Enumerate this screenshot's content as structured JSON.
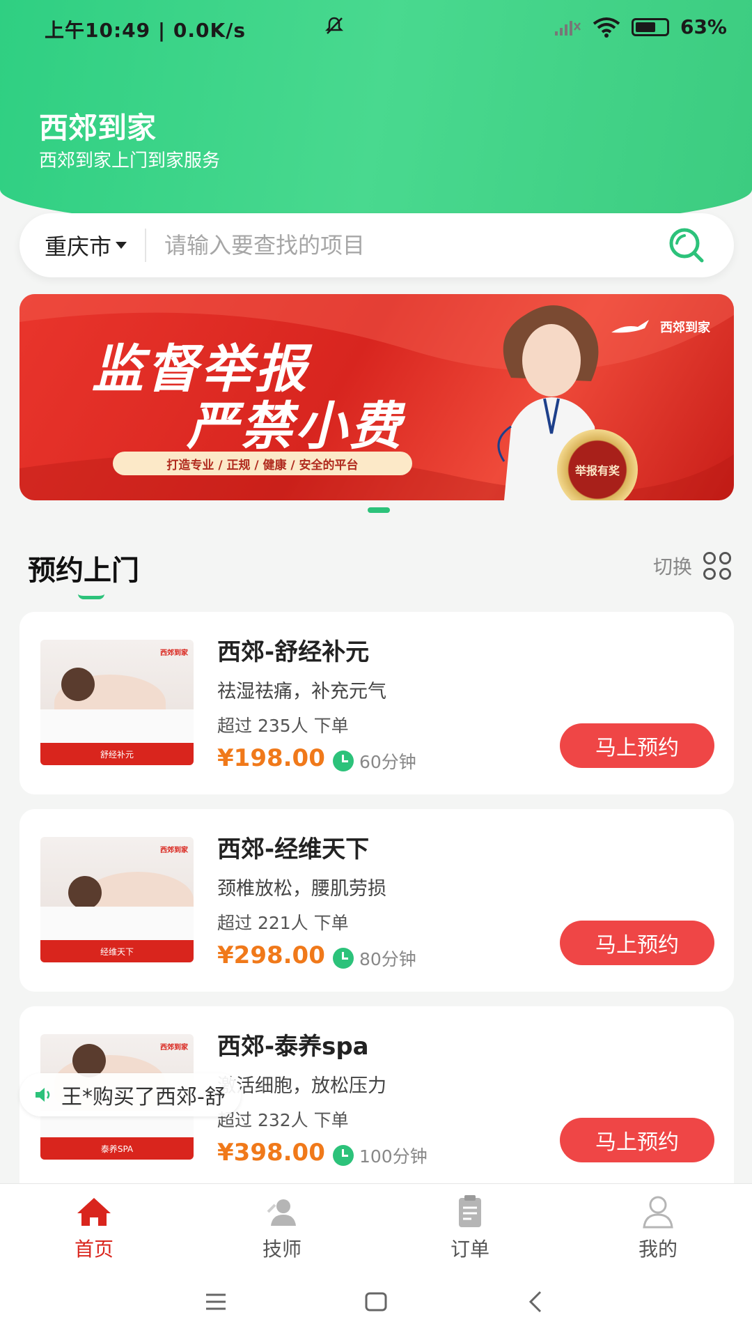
{
  "status_bar": {
    "time": "上午10:49 | 0.0K/s",
    "battery": "63%"
  },
  "header": {
    "title": "西郊到家",
    "subtitle": "西郊到家上门到家服务"
  },
  "search": {
    "city": "重庆市",
    "placeholder": "请输入要查找的项目"
  },
  "banner": {
    "line1": "监督举报",
    "line2": "严禁小费",
    "slogan": "打造专业 / 正规 / 健康 / 安全的平台",
    "brand": "西郊到家",
    "badge": "举报有奖"
  },
  "section": {
    "title": "预约上门",
    "switch_label": "切换"
  },
  "services": [
    {
      "name": "西郊-舒经补元",
      "description": "祛湿祛痛，补充元气",
      "orders": "超过 235人 下单",
      "price": "¥198.00",
      "duration": "60分钟",
      "button": "马上预约",
      "image_caption": "舒经补元"
    },
    {
      "name": "西郊-经维天下",
      "description": "颈椎放松，腰肌劳损",
      "orders": "超过 221人 下单",
      "price": "¥298.00",
      "duration": "80分钟",
      "button": "马上预约",
      "image_caption": "经维天下"
    },
    {
      "name": "西郊-泰养spa",
      "description": "激活细胞，放松压力",
      "orders": "超过 232人 下单",
      "price": "¥398.00",
      "duration": "100分钟",
      "button": "马上预约",
      "image_caption": "泰养SPA"
    }
  ],
  "toast": {
    "text": "王*购买了西郊-舒"
  },
  "tabbar": {
    "items": [
      {
        "label": "首页",
        "icon": "home-icon",
        "active": true
      },
      {
        "label": "技师",
        "icon": "technician-icon",
        "active": false
      },
      {
        "label": "订单",
        "icon": "orders-icon",
        "active": false
      },
      {
        "label": "我的",
        "icon": "profile-icon",
        "active": false
      }
    ]
  },
  "colors": {
    "brand_green": "#2cc27a",
    "accent_red": "#ef4646",
    "price_orange": "#f0791a"
  }
}
